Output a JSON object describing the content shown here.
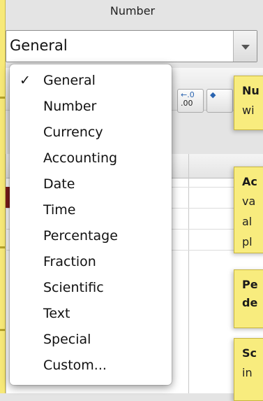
{
  "panel": {
    "group_title": "Number"
  },
  "format_select": {
    "value": "General"
  },
  "toolbar": {
    "increase_decimal_top": "←.0",
    "increase_decimal_bottom": ".00"
  },
  "menu": {
    "items": [
      {
        "label": "General",
        "checked": true
      },
      {
        "label": "Number"
      },
      {
        "label": "Currency"
      },
      {
        "label": "Accounting"
      },
      {
        "label": "Date"
      },
      {
        "label": "Time"
      },
      {
        "label": "Percentage"
      },
      {
        "label": "Fraction"
      },
      {
        "label": "Scientific"
      },
      {
        "label": "Text"
      },
      {
        "label": "Special"
      },
      {
        "label": "Custom..."
      }
    ],
    "check_mark": "✓"
  },
  "callouts": [
    {
      "lines": [
        "Nu",
        "wi"
      ],
      "bold_first": true
    },
    {
      "lines": [
        "Ac",
        "va",
        "al",
        "pl"
      ],
      "bold_first": true
    },
    {
      "lines": [
        "Pe",
        "de"
      ],
      "bold_first": true,
      "all_bold": true
    },
    {
      "lines": [
        "Sc",
        "in"
      ],
      "bold_first": true
    }
  ],
  "colors": {
    "callout_yellow": "#f8ec7e",
    "selected_cell": "#7b1b1b"
  }
}
